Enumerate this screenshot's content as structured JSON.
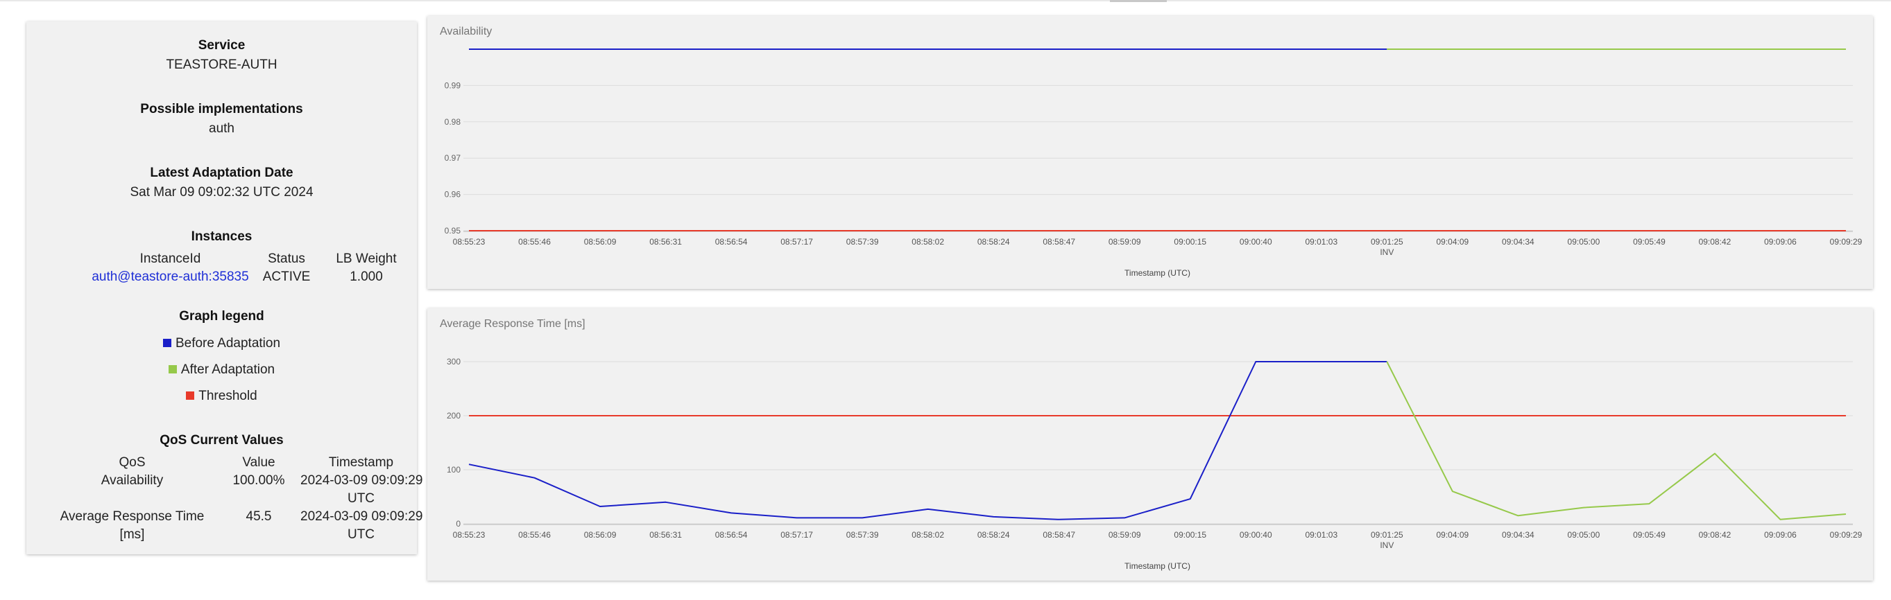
{
  "sidebar": {
    "service_heading": "Service",
    "service_value": "TEASTORE-AUTH",
    "impl_heading": "Possible implementations",
    "impl_value": "auth",
    "adapt_heading": "Latest Adaptation Date",
    "adapt_value": "Sat Mar 09 09:02:32 UTC 2024",
    "instances_heading": "Instances",
    "instances": {
      "headers": [
        "InstanceId",
        "Status",
        "LB Weight"
      ],
      "rows": [
        {
          "id": "auth@teastore-auth:35835",
          "status": "ACTIVE",
          "weight": "1.000"
        }
      ]
    },
    "legend_heading": "Graph legend",
    "legend": [
      {
        "label": "Before Adaptation",
        "color": "#1a1fc8"
      },
      {
        "label": "After Adaptation",
        "color": "#96c94a"
      },
      {
        "label": "Threshold",
        "color": "#e83a2a"
      }
    ],
    "qos_heading": "QoS Current Values",
    "qos": {
      "headers": [
        "QoS",
        "Value",
        "Timestamp"
      ],
      "rows": [
        {
          "name": "Availability",
          "value": "100.00%",
          "ts_line1": "2024-03-09 09:09:29",
          "ts_line2": "UTC"
        },
        {
          "name_line1": "Average Response Time",
          "name_line2": "[ms]",
          "value": "45.5",
          "ts_line1": "2024-03-09 09:09:29",
          "ts_line2": "UTC"
        }
      ]
    }
  },
  "charts": {
    "availability_title": "Availability",
    "response_title": "Average Response Time [ms]"
  },
  "chart_data": [
    {
      "type": "line",
      "title": "Availability",
      "xlabel": "Timestamp (UTC)",
      "ylabel": "",
      "ylim": [
        0.95,
        1.0
      ],
      "yticks": [
        "0.99",
        "0.98",
        "0.97",
        "0.96",
        "0.95"
      ],
      "x": [
        "08:55:23",
        "08:55:46",
        "08:56:09",
        "08:56:31",
        "08:56:54",
        "08:57:17",
        "08:57:39",
        "08:58:02",
        "08:58:24",
        "08:58:47",
        "08:59:09",
        "09:00:15",
        "09:00:40",
        "09:01:03",
        "09:01:25",
        "09:04:09",
        "09:04:34",
        "09:05:00",
        "09:05:49",
        "09:08:42",
        "09:09:06",
        "09:09:29"
      ],
      "marker": {
        "index": 14,
        "label": "INV"
      },
      "series": [
        {
          "name": "Before Adaptation",
          "color": "#1a1fc8",
          "values": [
            1,
            1,
            1,
            1,
            1,
            1,
            1,
            1,
            1,
            1,
            1,
            1,
            1,
            1,
            1,
            null,
            null,
            null,
            null,
            null,
            null,
            null
          ]
        },
        {
          "name": "After Adaptation",
          "color": "#96c94a",
          "values": [
            null,
            null,
            null,
            null,
            null,
            null,
            null,
            null,
            null,
            null,
            null,
            null,
            null,
            null,
            1,
            1,
            1,
            1,
            1,
            1,
            1,
            1
          ]
        },
        {
          "name": "Threshold",
          "color": "#e83a2a",
          "values": [
            0.95,
            0.95,
            0.95,
            0.95,
            0.95,
            0.95,
            0.95,
            0.95,
            0.95,
            0.95,
            0.95,
            0.95,
            0.95,
            0.95,
            0.95,
            0.95,
            0.95,
            0.95,
            0.95,
            0.95,
            0.95,
            0.95
          ]
        }
      ],
      "grid": true
    },
    {
      "type": "line",
      "title": "Average Response Time [ms]",
      "xlabel": "Timestamp (UTC)",
      "ylabel": "",
      "ylim": [
        0,
        300
      ],
      "yticks": [
        "300",
        "200",
        "100",
        "0"
      ],
      "x": [
        "08:55:23",
        "08:55:46",
        "08:56:09",
        "08:56:31",
        "08:56:54",
        "08:57:17",
        "08:57:39",
        "08:58:02",
        "08:58:24",
        "08:58:47",
        "08:59:09",
        "09:00:15",
        "09:00:40",
        "09:01:03",
        "09:01:25",
        "09:04:09",
        "09:04:34",
        "09:05:00",
        "09:05:49",
        "09:08:42",
        "09:09:06",
        "09:09:29"
      ],
      "marker": {
        "index": 14,
        "label": "INV"
      },
      "series": [
        {
          "name": "Before Adaptation",
          "color": "#1a1fc8",
          "values": [
            110,
            85,
            32,
            40,
            20,
            11,
            11,
            27,
            13,
            8,
            11,
            46,
            300,
            300,
            300,
            null,
            null,
            null,
            null,
            null,
            null,
            null
          ]
        },
        {
          "name": "After Adaptation",
          "color": "#96c94a",
          "values": [
            null,
            null,
            null,
            null,
            null,
            null,
            null,
            null,
            null,
            null,
            null,
            null,
            null,
            null,
            300,
            60,
            15,
            30,
            37,
            130,
            8,
            18
          ]
        },
        {
          "name": "Threshold",
          "color": "#e83a2a",
          "values": [
            200,
            200,
            200,
            200,
            200,
            200,
            200,
            200,
            200,
            200,
            200,
            200,
            200,
            200,
            200,
            200,
            200,
            200,
            200,
            200,
            200,
            200
          ]
        }
      ],
      "grid": true
    }
  ]
}
